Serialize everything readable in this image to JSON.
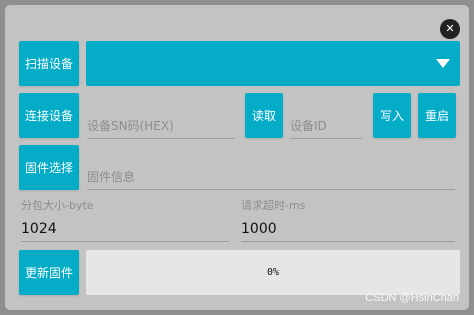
{
  "dialog": {
    "close_icon": "close-icon"
  },
  "buttons": {
    "scan": "扫描设备",
    "connect": "连接设备",
    "read": "读取",
    "write": "写入",
    "restart": "重启",
    "firmware_select": "固件选择",
    "update_firmware": "更新固件"
  },
  "device_dropdown": {
    "selected": "",
    "icon": "chevron-down-icon"
  },
  "fields": {
    "device_sn_placeholder": "设备SN码(HEX)",
    "device_id_placeholder": "设备ID",
    "firmware_info_placeholder": "固件信息",
    "packet_size_label": "分包大小-byte",
    "packet_size_value": "1024",
    "timeout_label": "请求超时-ms",
    "timeout_value": "1000"
  },
  "progress": {
    "value": 0,
    "label": "0%"
  },
  "watermark": "CSDN @HsinChan",
  "colors": {
    "accent": "#04acc7",
    "panel_background": "#c3c3c3",
    "progress_track": "#e6e6e6"
  }
}
